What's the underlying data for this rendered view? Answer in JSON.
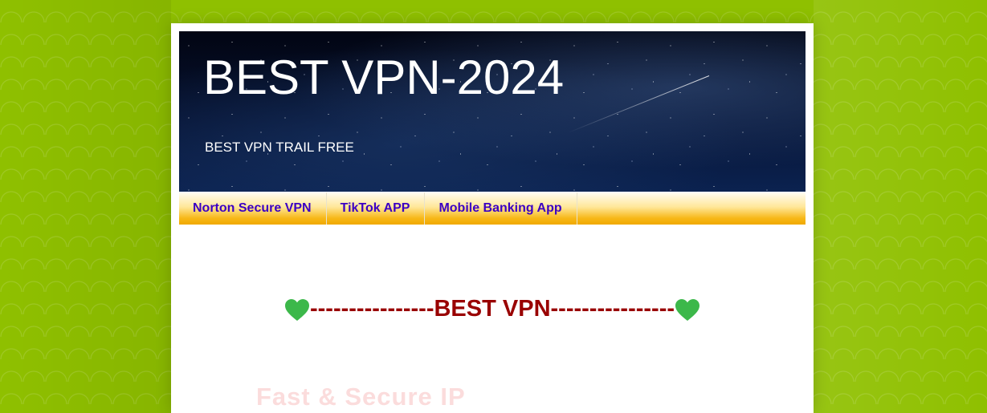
{
  "header": {
    "title": "BEST VPN-2024",
    "description": "BEST VPN TRAIL FREE"
  },
  "nav": {
    "items": [
      {
        "label": "Norton Secure VPN"
      },
      {
        "label": "TikTok APP"
      },
      {
        "label": "Mobile Banking App"
      }
    ]
  },
  "post": {
    "heading_text": "----------------BEST VPN----------------",
    "heart_icon": "green-heart-icon",
    "subtitle": "Fast & Secure IP"
  },
  "colors": {
    "background": "#8fc000",
    "nav_text": "#3b00c4",
    "heading": "#990000",
    "heart": "#3cb84a",
    "subtitle_faded": "#fbdcdc"
  }
}
